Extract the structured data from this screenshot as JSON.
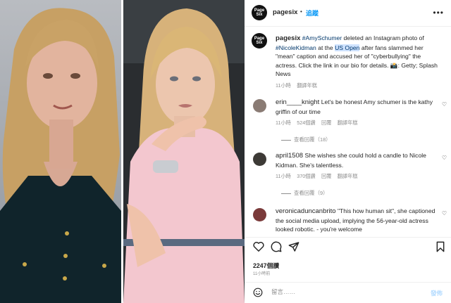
{
  "header": {
    "username": "pagesix",
    "follow_label": "追蹤",
    "avatar_text": "Page Six",
    "more_icon": "more-horizontal-icon"
  },
  "caption": {
    "username": "pagesix",
    "seg1": "#AmySchumer",
    "seg2": " deleted an Instagram photo of ",
    "seg3": "#NicoleKidman",
    "seg4": " at the ",
    "seg5": "US Open",
    "seg6": " after fans slammed her \"mean\" caption and accused her of \"cyberbullying\" the actress. Click the link in our bio for details. 📸: Getty; Splash News",
    "time": "11小時",
    "translate": "翻譯年糕"
  },
  "comments": [
    {
      "username": "erin____knight",
      "text": "Let's be honest Amy schumer is the kathy griffin of our time",
      "time": "11小時",
      "likes": "524個讚",
      "reply": "回覆",
      "translate": "翻譯年糕",
      "replies": "查看回覆（18）",
      "avatar_color": "#8a7b74"
    },
    {
      "username": "april1508",
      "text": "She wishes she could hold a candle to Nicole Kidman. She's talentless.",
      "time": "11小時",
      "likes": "370個讚",
      "reply": "回覆",
      "translate": "翻譯年糕",
      "replies": "查看回覆（9）",
      "avatar_color": "#3d3a36"
    },
    {
      "username": "veronicaduncanbrito",
      "text": "\"This how human sit\", she captioned the social media upload, implying the 56-year-old actress looked robotic. - you're welcome",
      "avatar_color": "#7a3a3a"
    }
  ],
  "actions": {
    "like": "heart-icon",
    "comment": "comment-icon",
    "share": "share-icon",
    "save": "bookmark-icon"
  },
  "likes": "2247個讚",
  "posted_ago": "11小時前",
  "add_comment": {
    "placeholder": "留言……",
    "post_label": "發佈",
    "emoji": "emoji-icon"
  }
}
